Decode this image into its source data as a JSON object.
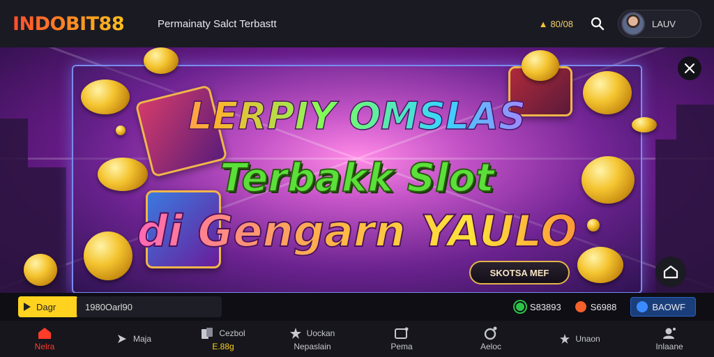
{
  "header": {
    "logo": "INDOBIT88",
    "title": "Permainaty Salct Terbastt",
    "balance": "80/08",
    "profile_name": "LAUV"
  },
  "hero": {
    "headline_1": "LERPIY OMSLAS",
    "headline_2": "Terbakk Slot",
    "headline_3": "di Gengarn YAULO",
    "cta_label": "SKOTSA MEF"
  },
  "infobar": {
    "play_label": "Dagr",
    "code_value": "1980Oarl90",
    "stat_1": "S83893",
    "stat_2": "S6988",
    "stat_3": "BAOWF"
  },
  "nav": {
    "items": [
      {
        "label": "Nelra"
      },
      {
        "label": "Maja"
      },
      {
        "label": "Cezbol",
        "sublabel": "E.88g"
      },
      {
        "label": "Uockan",
        "sublabel": "Nepaslain"
      },
      {
        "label": "Pema"
      },
      {
        "label": "Aeloc"
      },
      {
        "label": "Unaon"
      },
      {
        "label": "Inlaane"
      }
    ]
  },
  "colors": {
    "accent": "#ff3b2a",
    "gold": "#ffd21f",
    "banner_border": "#7a8cf0"
  },
  "icons": [
    "coin-icon",
    "search-icon",
    "close-icon",
    "home-icon",
    "sparkle-icon",
    "cards-icon",
    "star-icon",
    "gift-icon",
    "chat-icon",
    "user-icon",
    "play-icon"
  ]
}
